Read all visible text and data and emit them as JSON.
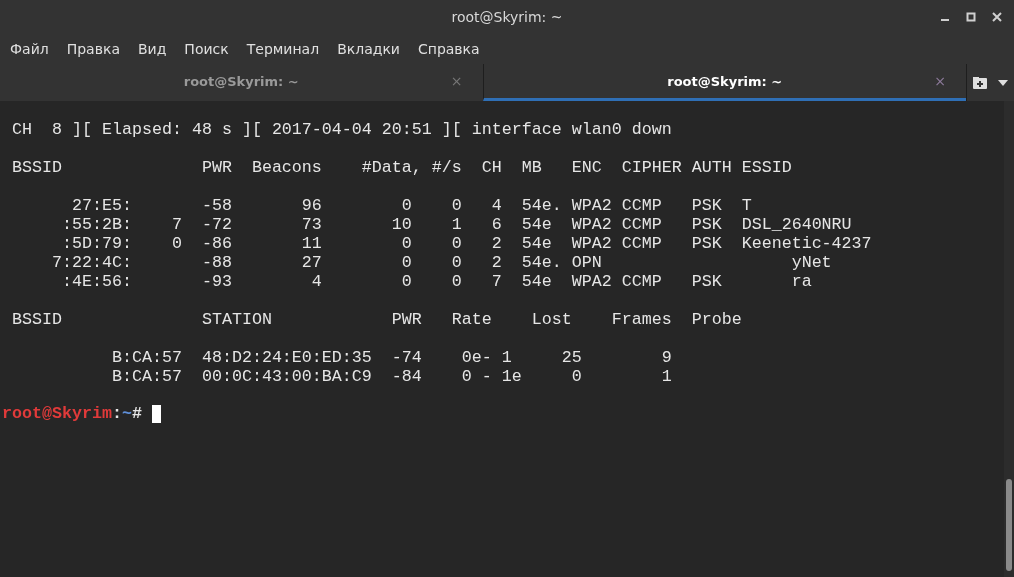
{
  "window": {
    "title": "root@Skyrim: ~"
  },
  "menu": [
    "Файл",
    "Правка",
    "Вид",
    "Поиск",
    "Терминал",
    "Вкладки",
    "Справка"
  ],
  "tabs": [
    {
      "label": "root@Skyrim: ~",
      "selected": false,
      "close": "×"
    },
    {
      "label": "root@Skyrim: ~",
      "selected": true,
      "close": "×"
    }
  ],
  "terminal": {
    "status": " CH  8 ][ Elapsed: 48 s ][ 2017-04-04 20:51 ][ interface wlan0 down",
    "ap_header": " BSSID              PWR  Beacons    #Data, #/s  CH  MB   ENC  CIPHER AUTH ESSID",
    "ap_rows": [
      "       27:E5:       -58       96        0    0   4  54e. WPA2 CCMP   PSK  T",
      "      :55:2B:    7  -72       73       10    1   6  54e  WPA2 CCMP   PSK  DSL_2640NRU",
      "      :5D:79:    0  -86       11        0    0   2  54e  WPA2 CCMP   PSK  Keenetic-4237",
      "     7:22:4C:       -88       27        0    0   2  54e. OPN                   yNet",
      "      :4E:56:       -93        4        0    0   7  54e  WPA2 CCMP   PSK       ra"
    ],
    "station_header": " BSSID              STATION            PWR   Rate    Lost    Frames  Probe",
    "station_rows": [
      "           B:CA:57  48:D2:24:E0:ED:35  -74    0e- 1     25        9",
      "           B:CA:57  00:0C:43:00:BA:C9  -84    0 - 1e     0        1"
    ],
    "prompt": {
      "user_host": "root@Skyrim",
      "separator": ":",
      "path": "~",
      "symbol": "# "
    }
  }
}
